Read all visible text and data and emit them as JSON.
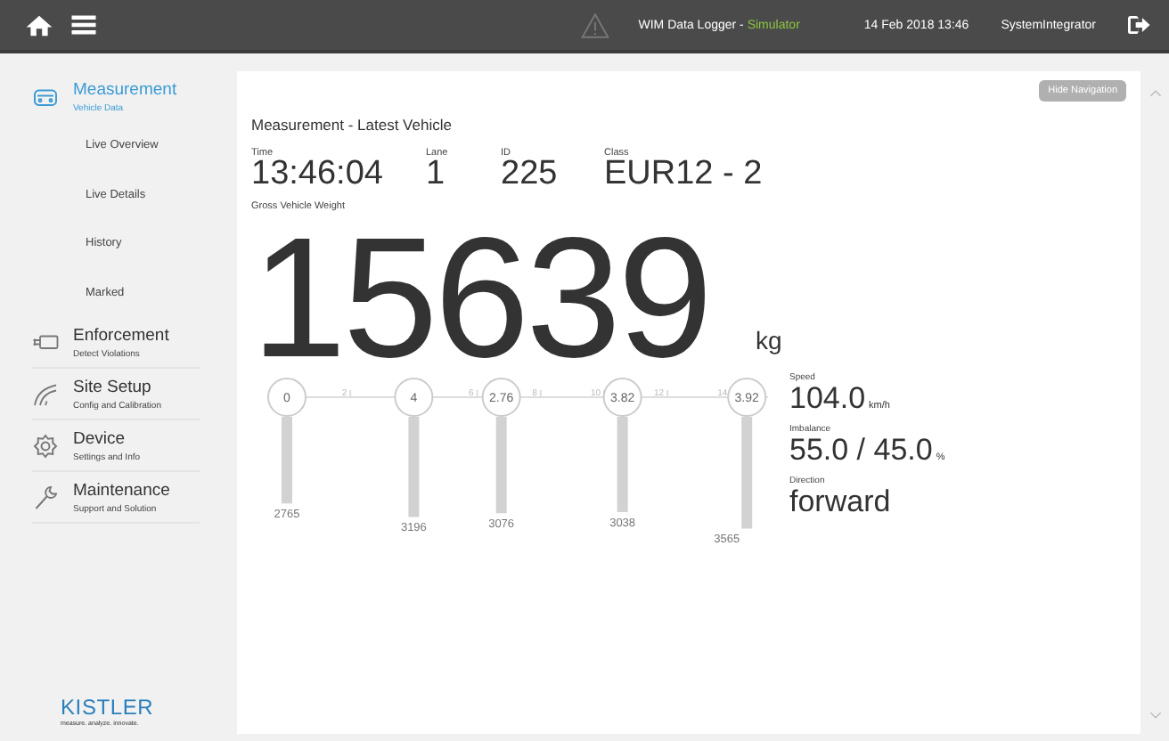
{
  "top_bar": {
    "app_title": "WIM Data Logger",
    "separator": " - ",
    "mode": "Simulator",
    "datetime": "14 Feb 2018 13:46",
    "user": "SystemIntegrator"
  },
  "sidebar": {
    "items": [
      {
        "label": "Measurement",
        "sublabel": "Vehicle Data",
        "selected": true,
        "children": [
          {
            "label": "Live Overview"
          },
          {
            "label": "Live Details"
          },
          {
            "label": "History"
          },
          {
            "label": "Marked"
          }
        ]
      },
      {
        "label": "Enforcement",
        "sublabel": "Detect Violations",
        "selected": false
      },
      {
        "label": "Site Setup",
        "sublabel": "Config and Calibration",
        "selected": false
      },
      {
        "label": "Device",
        "sublabel": "Settings and Info",
        "selected": false
      },
      {
        "label": "Maintenance",
        "sublabel": "Support and Solution",
        "selected": false
      }
    ],
    "logo": {
      "name": "KISTLER",
      "tagline": "measure. analyze. innovate."
    }
  },
  "main": {
    "hide_button": "Hide Navigation",
    "heading": "Measurement - Latest Vehicle",
    "fields": [
      {
        "label": "Time",
        "value": "13:46:04"
      },
      {
        "label": "Lane",
        "value": "1"
      },
      {
        "label": "ID",
        "value": "225"
      },
      {
        "label": "Class",
        "value": "EUR12 - 2"
      }
    ],
    "gross_label": "Gross Vehicle Weight",
    "gross_value": "15639",
    "gross_unit": "kg",
    "ruler_ticks": [
      "2",
      "6",
      "8",
      "10",
      "12",
      "14"
    ],
    "axles": [
      {
        "spacing": "0",
        "load": "2765"
      },
      {
        "spacing": "4",
        "load": "3196"
      },
      {
        "spacing": "2.76",
        "load": "3076"
      },
      {
        "spacing": "3.82",
        "load": "3038"
      },
      {
        "spacing": "3.92",
        "load": "3565"
      }
    ],
    "stats": [
      {
        "label": "Speed",
        "value": "104.0",
        "unit": "km/h"
      },
      {
        "label": "Imbalance",
        "value": "55.0 / 45.0",
        "unit": "%"
      },
      {
        "label": "Direction",
        "value": "forward"
      }
    ]
  }
}
